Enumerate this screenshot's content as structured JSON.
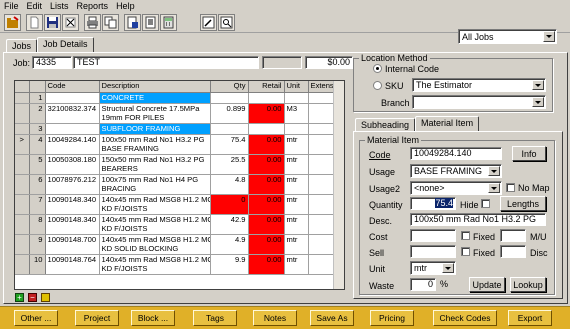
{
  "menu": [
    "File",
    "Edit",
    "Lists",
    "Reports",
    "Help"
  ],
  "job_selector": {
    "value": "All Jobs"
  },
  "tabs": {
    "jobs": "Jobs",
    "job_details": "Job Details"
  },
  "job": {
    "label": "Job:",
    "number": "4335",
    "name": "TEST",
    "total": "$0.00"
  },
  "grid": {
    "headers": [
      "Code",
      "Description",
      "Qty",
      "Retail",
      "Unit",
      "Extension"
    ],
    "rows": [
      {
        "num": "1",
        "code": "",
        "desc": "CONCRETE",
        "qty": "",
        "retail": "",
        "unit": "",
        "ext": "",
        "heading": true
      },
      {
        "num": "2",
        "code": "32100832.374",
        "desc": "Structural Concrete 17.5MPa",
        "desc2": "19mm FOR PILES",
        "qty": "0.899",
        "retail": "0.00",
        "unit": "M3",
        "ext": ""
      },
      {
        "num": "3",
        "code": "",
        "desc": "SUBFLOOR FRAMING",
        "qty": "",
        "retail": "",
        "unit": "",
        "ext": "",
        "heading": true
      },
      {
        "num": "4",
        "code": "10049284.140",
        "desc": "100x50 mm Rad No1 H3.2 PG",
        "desc2": "BASE FRAMING",
        "qty": "75.4",
        "retail": "0.00",
        "unit": "mtr",
        "ext": "",
        "current": true
      },
      {
        "num": "5",
        "code": "10050308.180",
        "desc": "150x50 mm Rad No1 H3.2 PG",
        "desc2": "BEARERS",
        "qty": "25.5",
        "retail": "0.00",
        "unit": "mtr",
        "ext": ""
      },
      {
        "num": "6",
        "code": "10078976.212",
        "desc": "100x75 mm Rad No1 H4 PG",
        "desc2": "BRACING",
        "qty": "4.8",
        "retail": "0.00",
        "unit": "mtr",
        "ext": ""
      },
      {
        "num": "7",
        "code": "10090148.340",
        "desc": "140x45 mm Rad MSG8 H1.2 MG",
        "desc2": "KD F/JOISTS",
        "qty": "0",
        "retail": "0.00",
        "unit": "mtr",
        "ext": "",
        "qtyred": true
      },
      {
        "num": "8",
        "code": "10090148.340",
        "desc": "140x45 mm Rad MSG8 H1.2 MG",
        "desc2": "KD F/JOISTS",
        "qty": "42.9",
        "retail": "0.00",
        "unit": "mtr",
        "ext": ""
      },
      {
        "num": "9",
        "code": "10090148.700",
        "desc": "140x45 mm Rad MSG8 H1.2 MG",
        "desc2": "KD SOLID BLOCKING",
        "qty": "4.9",
        "retail": "0.00",
        "unit": "mtr",
        "ext": ""
      },
      {
        "num": "10",
        "code": "10090148.764",
        "desc": "140x45 mm Rad MSG8 H1.2 MG",
        "desc2": "KD F/JOISTS",
        "qty": "9.9",
        "retail": "0.00",
        "unit": "mtr",
        "ext": ""
      }
    ]
  },
  "location": {
    "title": "Location Method",
    "internal_code": "Internal Code",
    "sku": "SKU",
    "sku_value": "The Estimator",
    "branch": "Branch",
    "branch_value": ""
  },
  "right_tabs": {
    "subheading": "Subheading",
    "material_item": "Material Item"
  },
  "material": {
    "group_title": "Material Item",
    "code_label": "Code",
    "code": "10049284.140",
    "info": "Info",
    "usage_label": "Usage",
    "usage": "BASE FRAMING",
    "usage2_label": "Usage2",
    "usage2": "<none>",
    "no_map": "No Map",
    "quantity_label": "Quantity",
    "quantity": "75.4",
    "hide": "Hide",
    "lengths": "Lengths",
    "desc_label": "Desc.",
    "desc": "100x50 mm Rad No1 H3.2 PG",
    "cost_label": "Cost",
    "fixed1": "Fixed",
    "mu": "M/U",
    "sell_label": "Sell",
    "fixed2": "Fixed",
    "disc": "Disc",
    "unit_label": "Unit",
    "unit": "mtr",
    "waste_label": "Waste",
    "waste": "0",
    "pct": "%",
    "update": "Update",
    "lookup": "Lookup"
  },
  "bottom_buttons": [
    "Other ...",
    "Project",
    "Block ...",
    "Tags",
    "Notes",
    "Save As",
    "Pricing",
    "Check Codes",
    "Export"
  ],
  "colors": {
    "heading_row": "#00a0ff",
    "price_cell": "#ff0000",
    "bottom_bar": "#e0b028"
  }
}
